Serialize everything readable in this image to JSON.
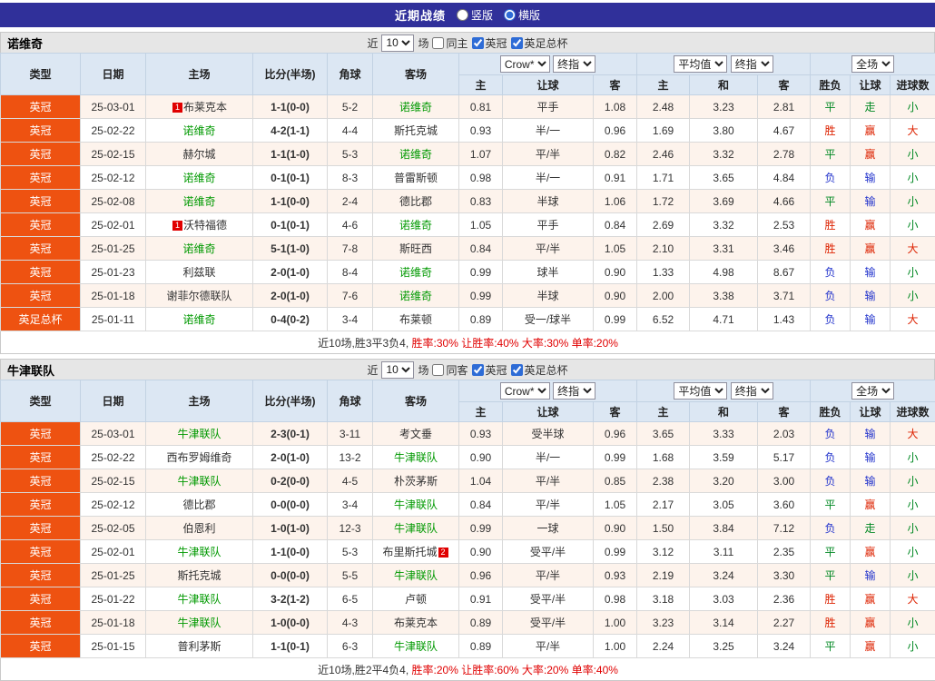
{
  "top_bar": {
    "title": "近期战绩",
    "radios": [
      {
        "label": "竖版",
        "selected": false
      },
      {
        "label": "横版",
        "selected": true
      }
    ]
  },
  "columns": {
    "type": "类型",
    "date": "日期",
    "home": "主场",
    "score": "比分(半场)",
    "corner": "角球",
    "away": "客场",
    "selects": {
      "book": "Crow*",
      "book_stage": "终指",
      "avg": "平均值",
      "avg_stage": "终指",
      "scope": "全场"
    },
    "odds_sub": [
      "主",
      "让球",
      "客"
    ],
    "avg_sub": [
      "主",
      "和",
      "客"
    ],
    "result_sub": [
      "胜负",
      "让球",
      "进球数"
    ]
  },
  "result_colors": {
    "胜": "#dd2200",
    "赢": "#dd2200",
    "大": "#dd2200",
    "负": "#2233cc",
    "输": "#2233cc",
    "平": "#008822",
    "走": "#008822",
    "小": "#008822"
  },
  "accent": {
    "league_badge_bg": "#ee5211",
    "focal_team_green": "#009900",
    "topbar_bg": "#30309a",
    "summary_red": "#e00000"
  },
  "sections": [
    {
      "team": "诺维奇",
      "filter": {
        "prefix": "近",
        "count": "10",
        "suffix": "场",
        "checkboxes": [
          {
            "label": "同主",
            "checked": false
          },
          {
            "label": "英冠",
            "checked": true
          },
          {
            "label": "英足总杯",
            "checked": true
          }
        ]
      },
      "rows": [
        {
          "league": "英冠",
          "date": "25-03-01",
          "home": {
            "badge": "1",
            "badge_pos": "left",
            "name": "布莱克本",
            "focal": false
          },
          "score": "1-1(0-0)",
          "corner": "5-2",
          "away": {
            "name": "诺维奇",
            "focal": true
          },
          "odds1": [
            "0.81",
            "平手",
            "1.08"
          ],
          "odds2": [
            "2.48",
            "3.23",
            "2.81"
          ],
          "results": [
            "平",
            "走",
            "小"
          ]
        },
        {
          "league": "英冠",
          "date": "25-02-22",
          "home": {
            "name": "诺维奇",
            "focal": true
          },
          "score": "4-2(1-1)",
          "corner": "4-4",
          "away": {
            "name": "斯托克城",
            "focal": false
          },
          "odds1": [
            "0.93",
            "半/一",
            "0.96"
          ],
          "odds2": [
            "1.69",
            "3.80",
            "4.67"
          ],
          "results": [
            "胜",
            "赢",
            "大"
          ]
        },
        {
          "league": "英冠",
          "date": "25-02-15",
          "home": {
            "name": "赫尔城",
            "focal": false
          },
          "score": "1-1(1-0)",
          "corner": "5-3",
          "away": {
            "name": "诺维奇",
            "focal": true
          },
          "odds1": [
            "1.07",
            "平/半",
            "0.82"
          ],
          "odds2": [
            "2.46",
            "3.32",
            "2.78"
          ],
          "results": [
            "平",
            "赢",
            "小"
          ]
        },
        {
          "league": "英冠",
          "date": "25-02-12",
          "home": {
            "name": "诺维奇",
            "focal": true
          },
          "score": "0-1(0-1)",
          "corner": "8-3",
          "away": {
            "name": "普雷斯顿",
            "focal": false
          },
          "odds1": [
            "0.98",
            "半/一",
            "0.91"
          ],
          "odds2": [
            "1.71",
            "3.65",
            "4.84"
          ],
          "results": [
            "负",
            "输",
            "小"
          ]
        },
        {
          "league": "英冠",
          "date": "25-02-08",
          "home": {
            "name": "诺维奇",
            "focal": true
          },
          "score": "1-1(0-0)",
          "corner": "2-4",
          "away": {
            "name": "德比郡",
            "focal": false
          },
          "odds1": [
            "0.83",
            "半球",
            "1.06"
          ],
          "odds2": [
            "1.72",
            "3.69",
            "4.66"
          ],
          "results": [
            "平",
            "输",
            "小"
          ]
        },
        {
          "league": "英冠",
          "date": "25-02-01",
          "home": {
            "badge": "1",
            "badge_pos": "left",
            "name": "沃特福德",
            "focal": false
          },
          "score": "0-1(0-1)",
          "corner": "4-6",
          "away": {
            "name": "诺维奇",
            "focal": true
          },
          "odds1": [
            "1.05",
            "平手",
            "0.84"
          ],
          "odds2": [
            "2.69",
            "3.32",
            "2.53"
          ],
          "results": [
            "胜",
            "赢",
            "小"
          ]
        },
        {
          "league": "英冠",
          "date": "25-01-25",
          "home": {
            "name": "诺维奇",
            "focal": true
          },
          "score": "5-1(1-0)",
          "corner": "7-8",
          "away": {
            "name": "斯旺西",
            "focal": false
          },
          "odds1": [
            "0.84",
            "平/半",
            "1.05"
          ],
          "odds2": [
            "2.10",
            "3.31",
            "3.46"
          ],
          "results": [
            "胜",
            "赢",
            "大"
          ]
        },
        {
          "league": "英冠",
          "date": "25-01-23",
          "home": {
            "name": "利兹联",
            "focal": false
          },
          "score": "2-0(1-0)",
          "corner": "8-4",
          "away": {
            "name": "诺维奇",
            "focal": true
          },
          "odds1": [
            "0.99",
            "球半",
            "0.90"
          ],
          "odds2": [
            "1.33",
            "4.98",
            "8.67"
          ],
          "results": [
            "负",
            "输",
            "小"
          ]
        },
        {
          "league": "英冠",
          "date": "25-01-18",
          "home": {
            "name": "谢菲尔德联队",
            "focal": false
          },
          "score": "2-0(1-0)",
          "corner": "7-6",
          "away": {
            "name": "诺维奇",
            "focal": true
          },
          "odds1": [
            "0.99",
            "半球",
            "0.90"
          ],
          "odds2": [
            "2.00",
            "3.38",
            "3.71"
          ],
          "results": [
            "负",
            "输",
            "小"
          ]
        },
        {
          "league": "英足总杯",
          "date": "25-01-11",
          "home": {
            "name": "诺维奇",
            "focal": true
          },
          "score": "0-4(0-2)",
          "corner": "3-4",
          "away": {
            "name": "布莱顿",
            "focal": false
          },
          "odds1": [
            "0.89",
            "受一/球半",
            "0.99"
          ],
          "odds2": [
            "6.52",
            "4.71",
            "1.43"
          ],
          "results": [
            "负",
            "输",
            "大"
          ]
        }
      ],
      "summary": {
        "record": "近10场,胜3平3负4,",
        "stats": " 胜率:30% 让胜率:40% 大率:30% 单率:20%"
      }
    },
    {
      "team": "牛津联队",
      "filter": {
        "prefix": "近",
        "count": "10",
        "suffix": "场",
        "checkboxes": [
          {
            "label": "同客",
            "checked": false
          },
          {
            "label": "英冠",
            "checked": true
          },
          {
            "label": "英足总杯",
            "checked": true
          }
        ]
      },
      "rows": [
        {
          "league": "英冠",
          "date": "25-03-01",
          "home": {
            "name": "牛津联队",
            "focal": true
          },
          "score": "2-3(0-1)",
          "corner": "3-11",
          "away": {
            "name": "考文垂",
            "focal": false
          },
          "odds1": [
            "0.93",
            "受半球",
            "0.96"
          ],
          "odds2": [
            "3.65",
            "3.33",
            "2.03"
          ],
          "results": [
            "负",
            "输",
            "大"
          ]
        },
        {
          "league": "英冠",
          "date": "25-02-22",
          "home": {
            "name": "西布罗姆维奇",
            "focal": false
          },
          "score": "2-0(1-0)",
          "corner": "13-2",
          "away": {
            "name": "牛津联队",
            "focal": true
          },
          "odds1": [
            "0.90",
            "半/一",
            "0.99"
          ],
          "odds2": [
            "1.68",
            "3.59",
            "5.17"
          ],
          "results": [
            "负",
            "输",
            "小"
          ]
        },
        {
          "league": "英冠",
          "date": "25-02-15",
          "home": {
            "name": "牛津联队",
            "focal": true
          },
          "score": "0-2(0-0)",
          "corner": "4-5",
          "away": {
            "name": "朴茨茅斯",
            "focal": false
          },
          "odds1": [
            "1.04",
            "平/半",
            "0.85"
          ],
          "odds2": [
            "2.38",
            "3.20",
            "3.00"
          ],
          "results": [
            "负",
            "输",
            "小"
          ]
        },
        {
          "league": "英冠",
          "date": "25-02-12",
          "home": {
            "name": "德比郡",
            "focal": false
          },
          "score": "0-0(0-0)",
          "corner": "3-4",
          "away": {
            "name": "牛津联队",
            "focal": true
          },
          "odds1": [
            "0.84",
            "平/半",
            "1.05"
          ],
          "odds2": [
            "2.17",
            "3.05",
            "3.60"
          ],
          "results": [
            "平",
            "赢",
            "小"
          ]
        },
        {
          "league": "英冠",
          "date": "25-02-05",
          "home": {
            "name": "伯恩利",
            "focal": false
          },
          "score": "1-0(1-0)",
          "corner": "12-3",
          "away": {
            "name": "牛津联队",
            "focal": true
          },
          "odds1": [
            "0.99",
            "一球",
            "0.90"
          ],
          "odds2": [
            "1.50",
            "3.84",
            "7.12"
          ],
          "results": [
            "负",
            "走",
            "小"
          ]
        },
        {
          "league": "英冠",
          "date": "25-02-01",
          "home": {
            "name": "牛津联队",
            "focal": true
          },
          "score": "1-1(0-0)",
          "corner": "5-3",
          "away": {
            "badge": "2",
            "badge_pos": "right",
            "name": "布里斯托城",
            "focal": false
          },
          "odds1": [
            "0.90",
            "受平/半",
            "0.99"
          ],
          "odds2": [
            "3.12",
            "3.11",
            "2.35"
          ],
          "results": [
            "平",
            "赢",
            "小"
          ]
        },
        {
          "league": "英冠",
          "date": "25-01-25",
          "home": {
            "name": "斯托克城",
            "focal": false
          },
          "score": "0-0(0-0)",
          "corner": "5-5",
          "away": {
            "name": "牛津联队",
            "focal": true
          },
          "odds1": [
            "0.96",
            "平/半",
            "0.93"
          ],
          "odds2": [
            "2.19",
            "3.24",
            "3.30"
          ],
          "results": [
            "平",
            "输",
            "小"
          ]
        },
        {
          "league": "英冠",
          "date": "25-01-22",
          "home": {
            "name": "牛津联队",
            "focal": true
          },
          "score": "3-2(1-2)",
          "corner": "6-5",
          "away": {
            "name": "卢顿",
            "focal": false
          },
          "odds1": [
            "0.91",
            "受平/半",
            "0.98"
          ],
          "odds2": [
            "3.18",
            "3.03",
            "2.36"
          ],
          "results": [
            "胜",
            "赢",
            "大"
          ]
        },
        {
          "league": "英冠",
          "date": "25-01-18",
          "home": {
            "name": "牛津联队",
            "focal": true
          },
          "score": "1-0(0-0)",
          "corner": "4-3",
          "away": {
            "name": "布莱克本",
            "focal": false
          },
          "odds1": [
            "0.89",
            "受平/半",
            "1.00"
          ],
          "odds2": [
            "3.23",
            "3.14",
            "2.27"
          ],
          "results": [
            "胜",
            "赢",
            "小"
          ]
        },
        {
          "league": "英冠",
          "date": "25-01-15",
          "home": {
            "name": "普利茅斯",
            "focal": false
          },
          "score": "1-1(0-1)",
          "corner": "6-3",
          "away": {
            "name": "牛津联队",
            "focal": true
          },
          "odds1": [
            "0.89",
            "平/半",
            "1.00"
          ],
          "odds2": [
            "2.24",
            "3.25",
            "3.24"
          ],
          "results": [
            "平",
            "赢",
            "小"
          ]
        }
      ],
      "summary": {
        "record": "近10场,胜2平4负4,",
        "stats": " 胜率:20% 让胜率:60% 大率:20% 单率:40%"
      }
    }
  ]
}
